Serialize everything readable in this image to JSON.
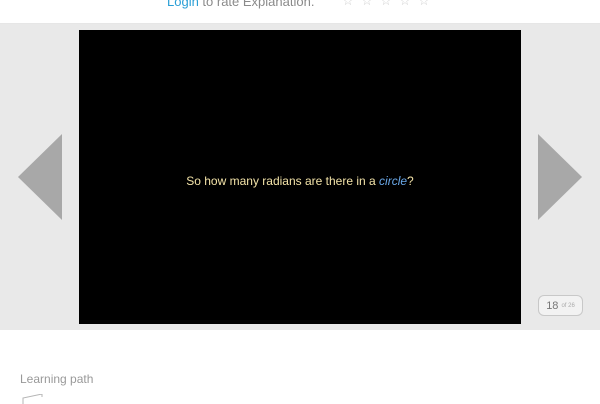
{
  "rating": {
    "login_label": "Login",
    "prompt": " to rate Explanation.",
    "stars": [
      "☆",
      "☆",
      "☆",
      "☆",
      "☆"
    ]
  },
  "slide": {
    "text_before": "So how many radians are there in a ",
    "term": "circle",
    "text_after": "?"
  },
  "counter": {
    "current": "18",
    "total": "of 26"
  },
  "learning_path": {
    "label": "Learning path",
    "icon": "path-icon"
  },
  "colors": {
    "accent": "#2a9fd6",
    "slide_text": "#f3e3a8",
    "slide_term": "#6aa8e8",
    "arrows": "#a8a8a8"
  }
}
